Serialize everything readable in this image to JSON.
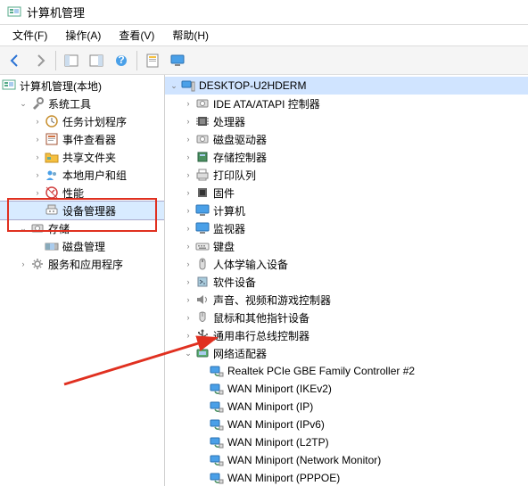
{
  "window": {
    "title": "计算机管理"
  },
  "menu": {
    "file": "文件(F)",
    "action": "操作(A)",
    "view": "查看(V)",
    "help": "帮助(H)"
  },
  "left_tree": {
    "root": "计算机管理(本地)",
    "system_tools": "系统工具",
    "task_scheduler": "任务计划程序",
    "event_viewer": "事件查看器",
    "shared_folders": "共享文件夹",
    "local_users": "本地用户和组",
    "performance": "性能",
    "device_manager": "设备管理器",
    "storage": "存储",
    "disk_mgmt": "磁盘管理",
    "services_apps": "服务和应用程序"
  },
  "right_tree": {
    "root": "DESKTOP-U2HDERM",
    "ide": "IDE ATA/ATAPI 控制器",
    "cpu": "处理器",
    "disk_drives": "磁盘驱动器",
    "storage_ctrl": "存储控制器",
    "print_queue": "打印队列",
    "firmware": "固件",
    "computer": "计算机",
    "monitor": "监视器",
    "keyboard": "键盘",
    "hid": "人体学输入设备",
    "soft_dev": "软件设备",
    "sound": "声音、视频和游戏控制器",
    "mouse": "鼠标和其他指针设备",
    "usb": "通用串行总线控制器",
    "network": "网络适配器",
    "realtek": "Realtek PCIe GBE Family Controller #2",
    "wan_ikev2": "WAN Miniport (IKEv2)",
    "wan_ip": "WAN Miniport (IP)",
    "wan_ipv6": "WAN Miniport (IPv6)",
    "wan_l2tp": "WAN Miniport (L2TP)",
    "wan_netmon": "WAN Miniport (Network Monitor)",
    "wan_pppoe": "WAN Miniport (PPPOE)"
  },
  "colors": {
    "highlight_box": "#e03020",
    "selected": "#d8ebff"
  }
}
